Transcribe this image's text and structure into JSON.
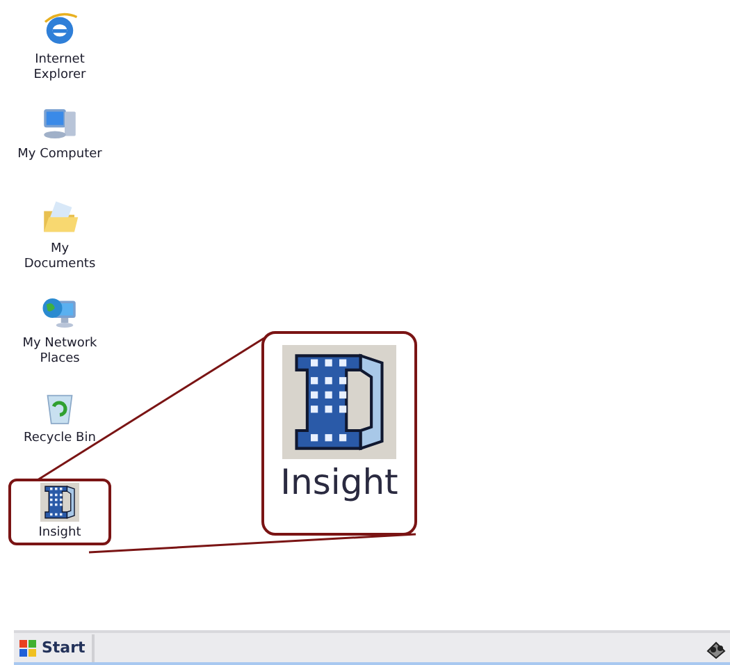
{
  "desktop_icons": [
    {
      "kind": "browser",
      "label": "Internet Explorer",
      "highlighted": false
    },
    {
      "kind": "computer",
      "label": "My Computer",
      "highlighted": false
    },
    {
      "kind": "documents",
      "label": "My Documents",
      "highlighted": false
    },
    {
      "kind": "network",
      "label": "My Network Places",
      "highlighted": false
    },
    {
      "kind": "recycle",
      "label": "Recycle Bin",
      "highlighted": false
    },
    {
      "kind": "building",
      "label": "Insight",
      "highlighted": true
    }
  ],
  "callout": {
    "label": "Insight"
  },
  "taskbar": {
    "start_button": "Start"
  }
}
